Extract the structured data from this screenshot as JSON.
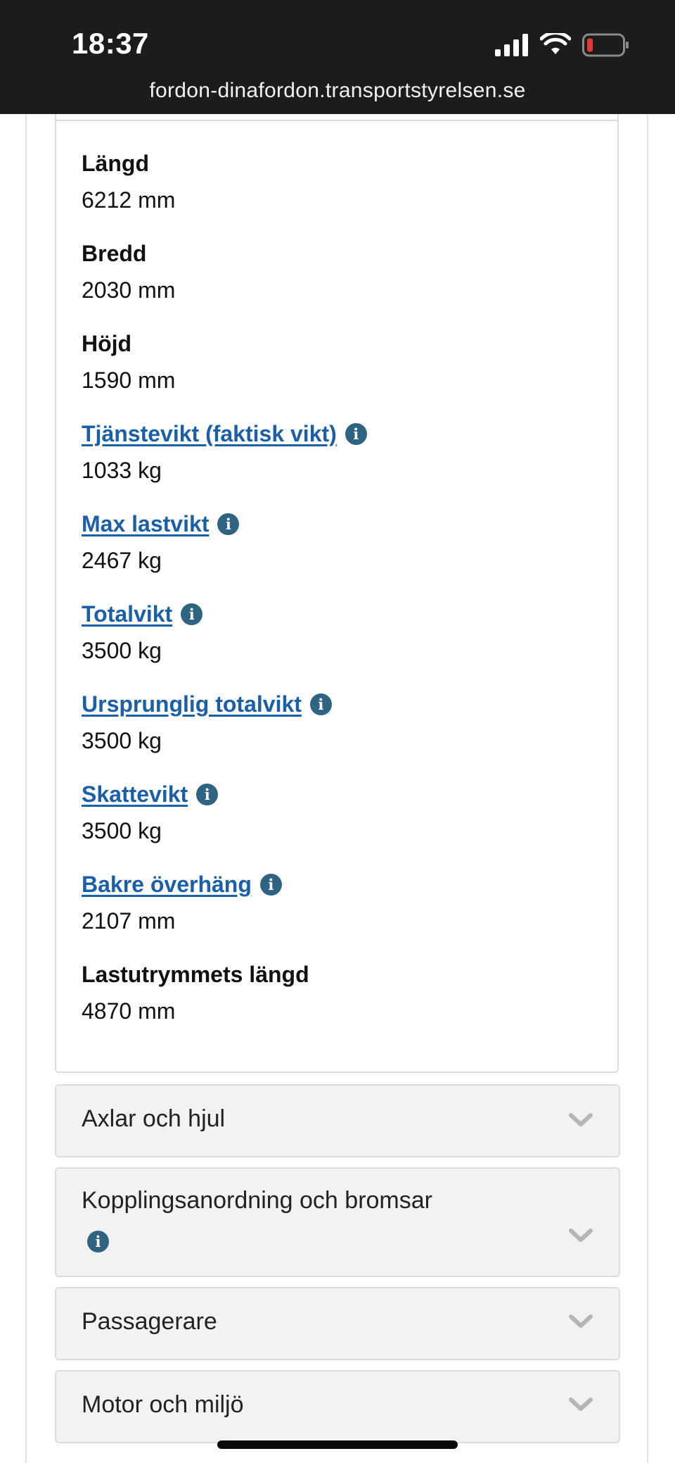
{
  "status_bar": {
    "time": "18:37",
    "url": "fordon-dinafordon.transportstyrelsen.se",
    "icons": [
      "signal-icon",
      "wifi-icon",
      "battery-low-icon"
    ]
  },
  "dimensions": {
    "fields": [
      {
        "label": "Längd",
        "value": "6212 mm",
        "link": false
      },
      {
        "label": "Bredd",
        "value": "2030 mm",
        "link": false
      },
      {
        "label": "Höjd",
        "value": "1590 mm",
        "link": false
      },
      {
        "label": "Tjänstevikt (faktisk vikt)",
        "value": "1033 kg",
        "link": true
      },
      {
        "label": "Max lastvikt",
        "value": "2467 kg",
        "link": true
      },
      {
        "label": "Totalvikt",
        "value": "3500 kg",
        "link": true
      },
      {
        "label": "Ursprunglig totalvikt",
        "value": "3500 kg",
        "link": true
      },
      {
        "label": "Skattevikt",
        "value": "3500 kg",
        "link": true
      },
      {
        "label": "Bakre överhäng",
        "value": "2107 mm",
        "link": true
      },
      {
        "label": "Lastutrymmets längd",
        "value": "4870 mm",
        "link": false
      }
    ]
  },
  "sections": [
    {
      "title": "Axlar och hjul"
    },
    {
      "title": "Kopplingsanordning och bromsar"
    },
    {
      "title": "Passagerare"
    },
    {
      "title": "Motor och miljö"
    }
  ],
  "colors": {
    "link": "#1a5fa7",
    "info_icon": "#2e6381",
    "status_bar_bg": "#1c1c1c",
    "accordion_bg": "#f2f2f2",
    "battery_low": "#e53935"
  }
}
